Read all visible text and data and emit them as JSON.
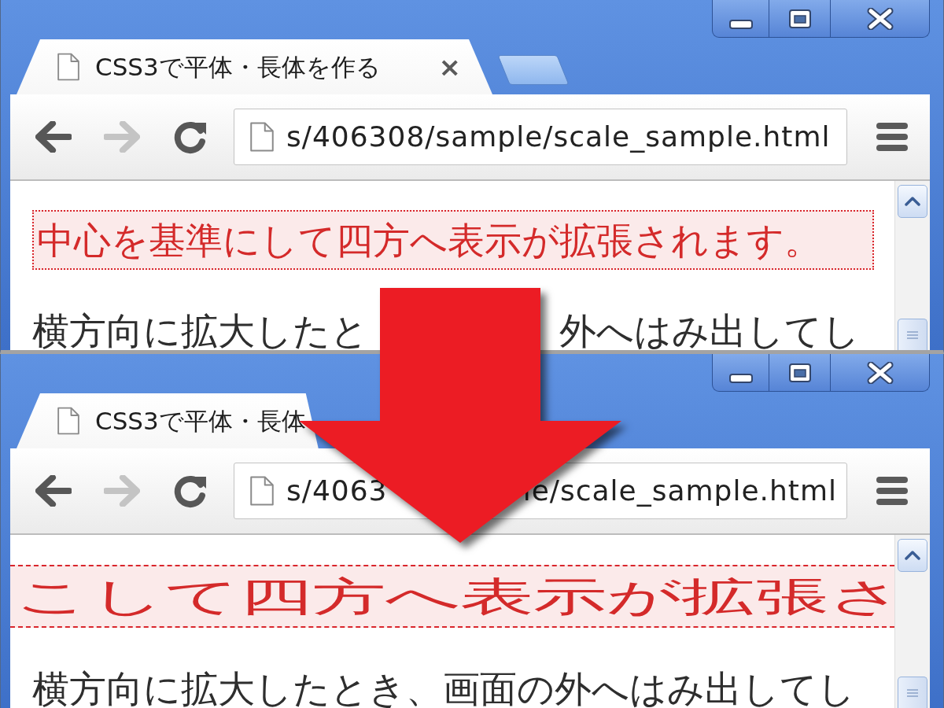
{
  "windows": [
    {
      "tab_strip": [
        {
          "kind": "tab",
          "title": "CSS3で平体・長体を作る",
          "close": "×"
        },
        {
          "kind": "new_tab"
        }
      ],
      "toolbar": {
        "nav": [
          {
            "kind": "back",
            "disabled": false
          },
          {
            "kind": "forward",
            "disabled": true
          },
          {
            "kind": "reload",
            "disabled": false
          }
        ],
        "url": [
          "s/406308/sample/scale_sample.html"
        ]
      },
      "content": [
        {
          "kind": "highlight",
          "text": [
            "中心を基準にして四方へ表示が拡張されます。"
          ]
        },
        {
          "kind": "paragraph",
          "text": [
            "横方向に拡大したと",
            "外へはみ出してし"
          ]
        }
      ]
    },
    {
      "tab_strip": [
        {
          "kind": "tab",
          "title": "CSS3で平体・長体"
        }
      ],
      "toolbar": {
        "nav": [
          {
            "kind": "back",
            "disabled": false
          },
          {
            "kind": "forward",
            "disabled": true
          },
          {
            "kind": "reload",
            "disabled": false
          }
        ],
        "url": [
          "s/4063",
          "le/scale_sample.html"
        ]
      },
      "content": [
        {
          "kind": "stretched_highlight",
          "text": [
            "こして四方へ表示が拡張さ"
          ]
        },
        {
          "kind": "paragraph",
          "text": [
            "横方向に拡大したとき、画面の外へはみ出してし"
          ]
        }
      ]
    }
  ]
}
